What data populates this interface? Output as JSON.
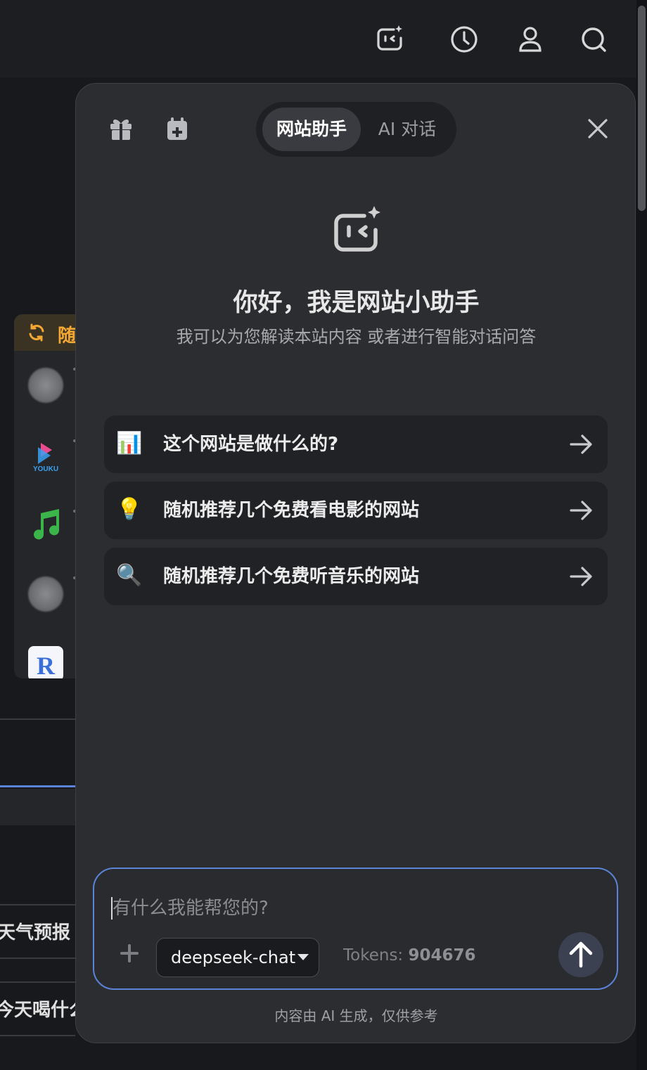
{
  "topbar": {
    "icons": [
      "ai-assistant-icon",
      "history-icon",
      "user-icon",
      "search-icon"
    ]
  },
  "background": {
    "random_card_title": "随",
    "bg_text_1": "天气预报",
    "bg_text_2": "今天喝什么"
  },
  "panel": {
    "tabs": [
      {
        "label": "网站助手",
        "active": true
      },
      {
        "label": "AI 对话",
        "active": false
      }
    ],
    "greeting_title": "你好，我是网站小助手",
    "greeting_sub": "我可以为您解读本站内容 或者进行智能对话问答",
    "suggestions": [
      {
        "emoji": "📊",
        "text": "这个网站是做什么的?"
      },
      {
        "emoji": "💡",
        "text": "随机推荐几个免费看电影的网站"
      },
      {
        "emoji": "🔍",
        "text": "随机推荐几个免费听音乐的网站"
      }
    ],
    "input": {
      "placeholder": "有什么我能帮您的?",
      "model": "deepseek-chat",
      "tokens_label": "Tokens:",
      "tokens_value": "904676"
    },
    "disclaimer": "内容由 AI 生成，仅供参考"
  },
  "colors": {
    "accent_border": "#5b84d8",
    "panel_bg": "#2c2d31",
    "random_title": "#f3a833"
  }
}
